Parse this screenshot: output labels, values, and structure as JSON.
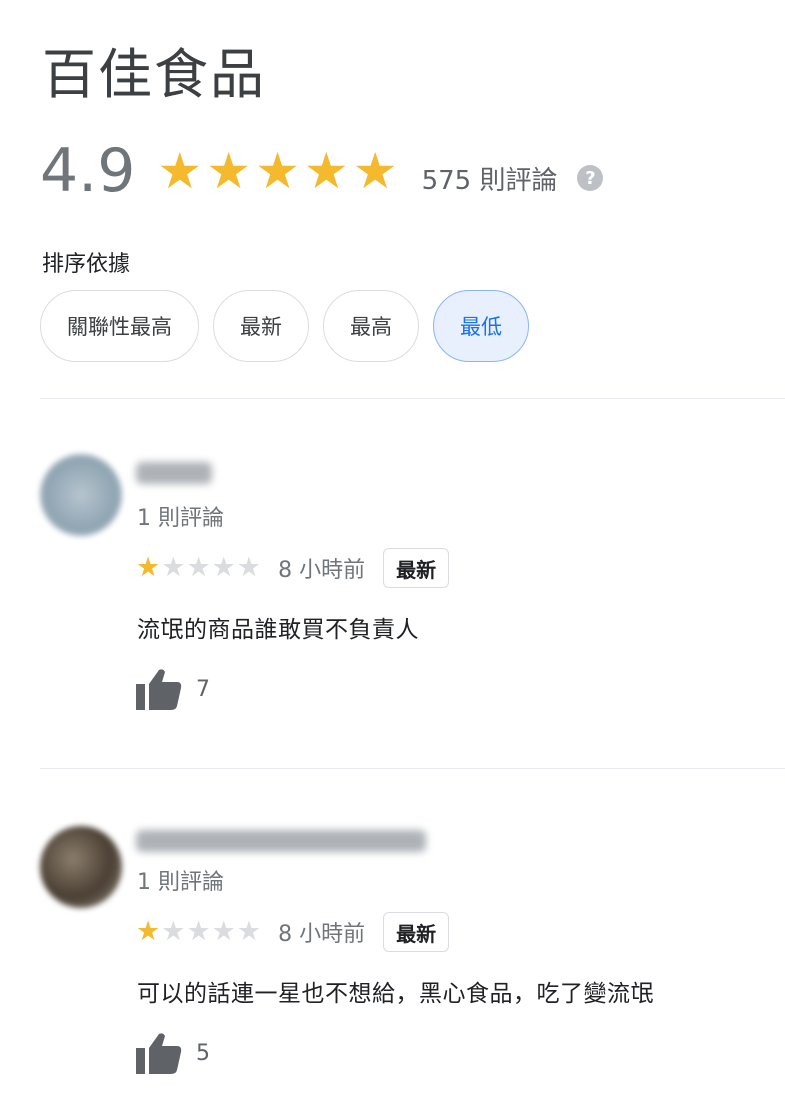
{
  "place": {
    "title": "百佳食品",
    "rating": "4.9",
    "review_count": "575 則評論",
    "help_icon": "?"
  },
  "sort": {
    "label": "排序依據",
    "chips": [
      {
        "label": "關聯性最高",
        "selected": false
      },
      {
        "label": "最新",
        "selected": false
      },
      {
        "label": "最高",
        "selected": false
      },
      {
        "label": "最低",
        "selected": true
      }
    ]
  },
  "reviews": [
    {
      "reviewer_count": "1 則評論",
      "stars": 1,
      "time": "8 小時前",
      "badge": "最新",
      "text": "流氓的商品誰敢買不負責人",
      "likes": "7"
    },
    {
      "reviewer_count": "1 則評論",
      "stars": 1,
      "time": "8 小時前",
      "badge": "最新",
      "text": "可以的話連一星也不想給，黑心食品，吃了變流氓",
      "likes": "5"
    }
  ],
  "icons": {
    "star": "star-icon",
    "help": "help-icon",
    "thumbs_up": "thumbs-up-icon"
  },
  "colors": {
    "star": "#f5b92d",
    "chip_active_bg": "#e8f0fe",
    "chip_active_text": "#1a73e8"
  }
}
